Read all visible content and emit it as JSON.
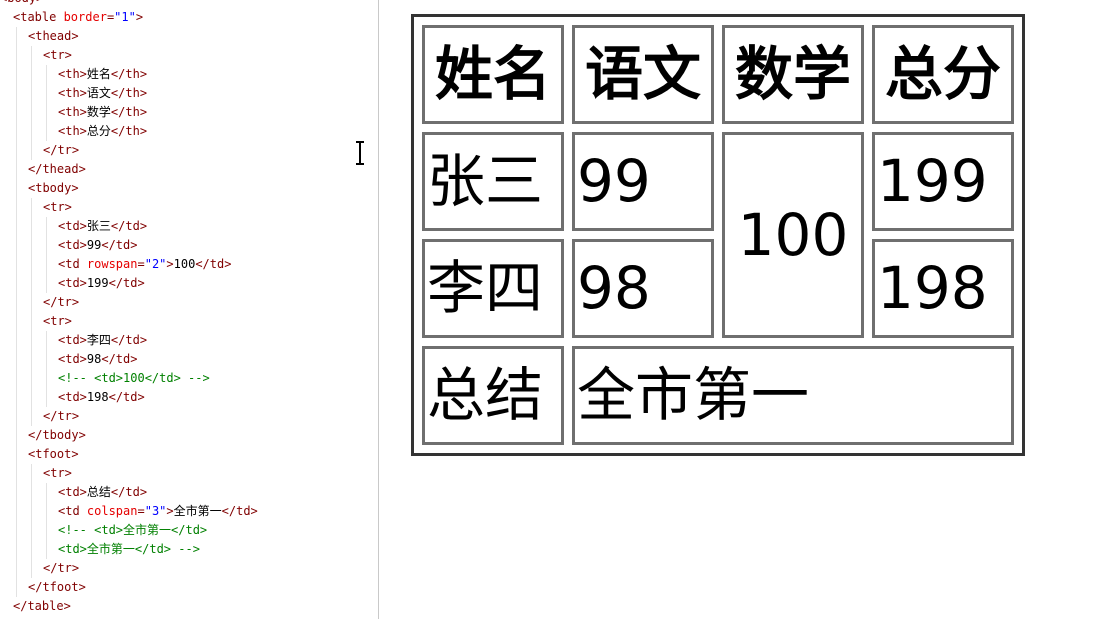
{
  "code_lines": [
    {
      "indent": 0,
      "parts": [
        {
          "t": "tag",
          "v": "<body>"
        }
      ]
    },
    {
      "indent": 1,
      "parts": [
        {
          "t": "tag",
          "v": "<table "
        },
        {
          "t": "attr",
          "v": "border"
        },
        {
          "t": "tag",
          "v": "="
        },
        {
          "t": "val",
          "v": "\"1\""
        },
        {
          "t": "tag",
          "v": ">"
        }
      ]
    },
    {
      "indent": 2,
      "parts": [
        {
          "t": "tag",
          "v": "<thead>"
        }
      ]
    },
    {
      "indent": 3,
      "parts": [
        {
          "t": "tag",
          "v": "<tr>"
        }
      ]
    },
    {
      "indent": 4,
      "parts": [
        {
          "t": "tag",
          "v": "<th>"
        },
        {
          "t": "txt",
          "v": "姓名"
        },
        {
          "t": "tag",
          "v": "</th>"
        }
      ]
    },
    {
      "indent": 4,
      "parts": [
        {
          "t": "tag",
          "v": "<th>"
        },
        {
          "t": "txt",
          "v": "语文"
        },
        {
          "t": "tag",
          "v": "</th>"
        }
      ]
    },
    {
      "indent": 4,
      "parts": [
        {
          "t": "tag",
          "v": "<th>"
        },
        {
          "t": "txt",
          "v": "数学"
        },
        {
          "t": "tag",
          "v": "</th>"
        }
      ]
    },
    {
      "indent": 4,
      "parts": [
        {
          "t": "tag",
          "v": "<th>"
        },
        {
          "t": "txt",
          "v": "总分"
        },
        {
          "t": "tag",
          "v": "</th>"
        }
      ]
    },
    {
      "indent": 3,
      "parts": [
        {
          "t": "tag",
          "v": "</tr>"
        }
      ]
    },
    {
      "indent": 2,
      "parts": [
        {
          "t": "tag",
          "v": "</thead>"
        }
      ]
    },
    {
      "indent": 2,
      "parts": [
        {
          "t": "tag",
          "v": "<tbody>"
        }
      ]
    },
    {
      "indent": 3,
      "parts": [
        {
          "t": "tag",
          "v": "<tr>"
        }
      ]
    },
    {
      "indent": 4,
      "parts": [
        {
          "t": "tag",
          "v": "<td>"
        },
        {
          "t": "txt",
          "v": "张三"
        },
        {
          "t": "tag",
          "v": "</td>"
        }
      ]
    },
    {
      "indent": 4,
      "parts": [
        {
          "t": "tag",
          "v": "<td>"
        },
        {
          "t": "txt",
          "v": "99"
        },
        {
          "t": "tag",
          "v": "</td>"
        }
      ]
    },
    {
      "indent": 4,
      "parts": [
        {
          "t": "tag",
          "v": "<td "
        },
        {
          "t": "attr",
          "v": "rowspan"
        },
        {
          "t": "tag",
          "v": "="
        },
        {
          "t": "val",
          "v": "\"2\""
        },
        {
          "t": "tag",
          "v": ">"
        },
        {
          "t": "txt",
          "v": "100"
        },
        {
          "t": "tag",
          "v": "</td>"
        }
      ]
    },
    {
      "indent": 4,
      "parts": [
        {
          "t": "tag",
          "v": "<td>"
        },
        {
          "t": "txt",
          "v": "199"
        },
        {
          "t": "tag",
          "v": "</td>"
        }
      ]
    },
    {
      "indent": 3,
      "parts": [
        {
          "t": "tag",
          "v": "</tr>"
        }
      ]
    },
    {
      "indent": 3,
      "parts": [
        {
          "t": "tag",
          "v": "<tr>"
        }
      ]
    },
    {
      "indent": 4,
      "parts": [
        {
          "t": "tag",
          "v": "<td>"
        },
        {
          "t": "txt",
          "v": "李四"
        },
        {
          "t": "tag",
          "v": "</td>"
        }
      ]
    },
    {
      "indent": 4,
      "parts": [
        {
          "t": "tag",
          "v": "<td>"
        },
        {
          "t": "txt",
          "v": "98"
        },
        {
          "t": "tag",
          "v": "</td>"
        }
      ]
    },
    {
      "indent": 4,
      "parts": [
        {
          "t": "cmt",
          "v": "<!-- <td>100</td> -->"
        }
      ]
    },
    {
      "indent": 4,
      "parts": [
        {
          "t": "tag",
          "v": "<td>"
        },
        {
          "t": "txt",
          "v": "198"
        },
        {
          "t": "tag",
          "v": "</td>"
        }
      ]
    },
    {
      "indent": 3,
      "parts": [
        {
          "t": "tag",
          "v": "</tr>"
        }
      ]
    },
    {
      "indent": 2,
      "parts": [
        {
          "t": "tag",
          "v": "</tbody>"
        }
      ]
    },
    {
      "indent": 2,
      "parts": [
        {
          "t": "tag",
          "v": "<tfoot>"
        }
      ]
    },
    {
      "indent": 3,
      "parts": [
        {
          "t": "tag",
          "v": "<tr>"
        }
      ]
    },
    {
      "indent": 4,
      "parts": [
        {
          "t": "tag",
          "v": "<td>"
        },
        {
          "t": "txt",
          "v": "总结"
        },
        {
          "t": "tag",
          "v": "</td>"
        }
      ]
    },
    {
      "indent": 4,
      "parts": [
        {
          "t": "tag",
          "v": "<td "
        },
        {
          "t": "attr",
          "v": "colspan"
        },
        {
          "t": "tag",
          "v": "="
        },
        {
          "t": "val",
          "v": "\"3\""
        },
        {
          "t": "tag",
          "v": ">"
        },
        {
          "t": "txt",
          "v": "全市第一"
        },
        {
          "t": "tag",
          "v": "</td>"
        }
      ]
    },
    {
      "indent": 4,
      "parts": [
        {
          "t": "cmt",
          "v": "<!-- <td>全市第一</td>"
        }
      ]
    },
    {
      "indent": 4,
      "parts": [
        {
          "t": "cmt",
          "v": "<td>全市第一</td> -->"
        }
      ]
    },
    {
      "indent": 3,
      "parts": [
        {
          "t": "tag",
          "v": "</tr>"
        }
      ]
    },
    {
      "indent": 2,
      "parts": [
        {
          "t": "tag",
          "v": "</tfoot>"
        }
      ]
    },
    {
      "indent": 1,
      "parts": [
        {
          "t": "tag",
          "v": "</table>"
        }
      ]
    }
  ],
  "table": {
    "headers": [
      "姓名",
      "语文",
      "数学",
      "总分"
    ],
    "row1": {
      "name": "张三",
      "chinese": "99",
      "math": "100",
      "total": "199"
    },
    "row2": {
      "name": "李四",
      "chinese": "98",
      "total": "198"
    },
    "footer": {
      "label": "总结",
      "summary": "全市第一"
    }
  }
}
